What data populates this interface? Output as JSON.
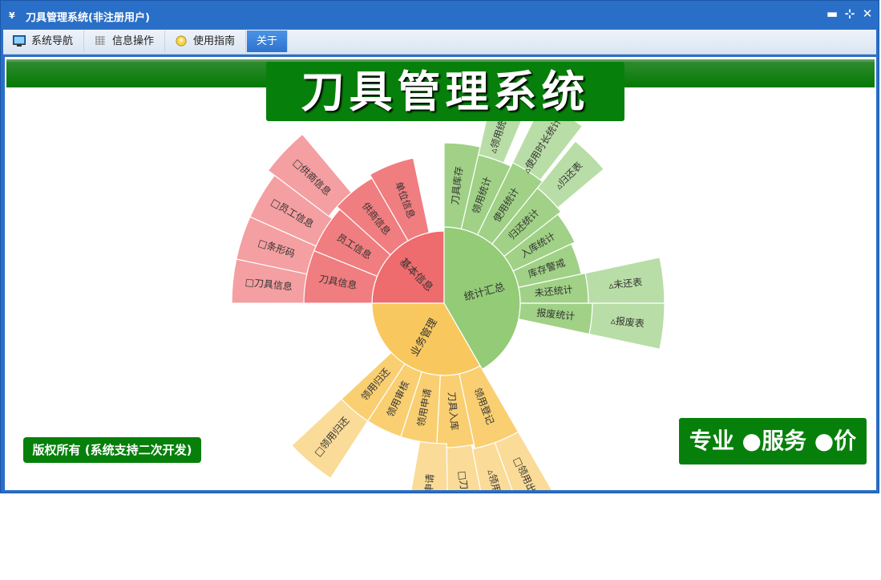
{
  "window": {
    "app_icon": "¥",
    "title": "刀具管理系统(非注册用户)",
    "controls": {
      "minimize": "▬",
      "restore": "⊹",
      "close": "✕"
    }
  },
  "menu": [
    {
      "label": "系统导航",
      "icon": "monitor-icon"
    },
    {
      "label": "信息操作",
      "icon": "grid-icon"
    },
    {
      "label": "使用指南",
      "icon": "bulb-icon"
    },
    {
      "label": "关于",
      "icon": "",
      "active": true
    }
  ],
  "banner": {
    "title": "刀具管理系统"
  },
  "sunburst": {
    "inner": [
      {
        "id": "jb",
        "label": "基本信息",
        "color": "#ee6b6e"
      },
      {
        "id": "tj",
        "label": "统计汇总",
        "color": "#93cb76"
      },
      {
        "id": "yw",
        "label": "业务管理",
        "color": "#f8c85f"
      }
    ],
    "ring2": [
      {
        "parent": "jb",
        "label": "刀具信息"
      },
      {
        "parent": "jb",
        "label": "员工信息"
      },
      {
        "parent": "jb",
        "label": "供商信息"
      },
      {
        "parent": "jb",
        "label": "单位信息"
      },
      {
        "parent": "tj",
        "label": "刀具库存"
      },
      {
        "parent": "tj",
        "label": "领用统计"
      },
      {
        "parent": "tj",
        "label": "使用统计"
      },
      {
        "parent": "tj",
        "label": "归还统计"
      },
      {
        "parent": "tj",
        "label": "入库统计"
      },
      {
        "parent": "tj",
        "label": "库存警戒"
      },
      {
        "parent": "tj",
        "label": "未还统计"
      },
      {
        "parent": "tj",
        "label": "报废统计"
      },
      {
        "parent": "yw",
        "label": "领用登记"
      },
      {
        "parent": "yw",
        "label": "刀具入库"
      },
      {
        "parent": "yw",
        "label": "领用申请"
      },
      {
        "parent": "yw",
        "label": "领用审核"
      },
      {
        "parent": "yw",
        "label": "领用归还"
      }
    ],
    "ring3": [
      {
        "parent": "jb",
        "label": "□刀具信息"
      },
      {
        "parent": "jb",
        "label": "□条形码"
      },
      {
        "parent": "jb",
        "label": "□员工信息"
      },
      {
        "parent": "jb",
        "label": "□供商信息"
      },
      {
        "parent": "tj",
        "label": "▵领用统计表"
      },
      {
        "parent": "tj",
        "label": "▵使用时长统计表"
      },
      {
        "parent": "tj",
        "label": "▵归还表"
      },
      {
        "parent": "tj",
        "label": "▵未还表"
      },
      {
        "parent": "tj",
        "label": "▵报废表"
      },
      {
        "parent": "yw",
        "label": "□领用出库"
      },
      {
        "parent": "yw",
        "label": "▵领用申请"
      },
      {
        "parent": "yw",
        "label": "□刀具入库"
      },
      {
        "parent": "yw",
        "label": "领用申请"
      },
      {
        "parent": "yw",
        "label": "□领用归还"
      }
    ]
  },
  "copyright": "版权所有 (系统支持二次开发)",
  "slogan": "专业 ●服务 ●价值"
}
